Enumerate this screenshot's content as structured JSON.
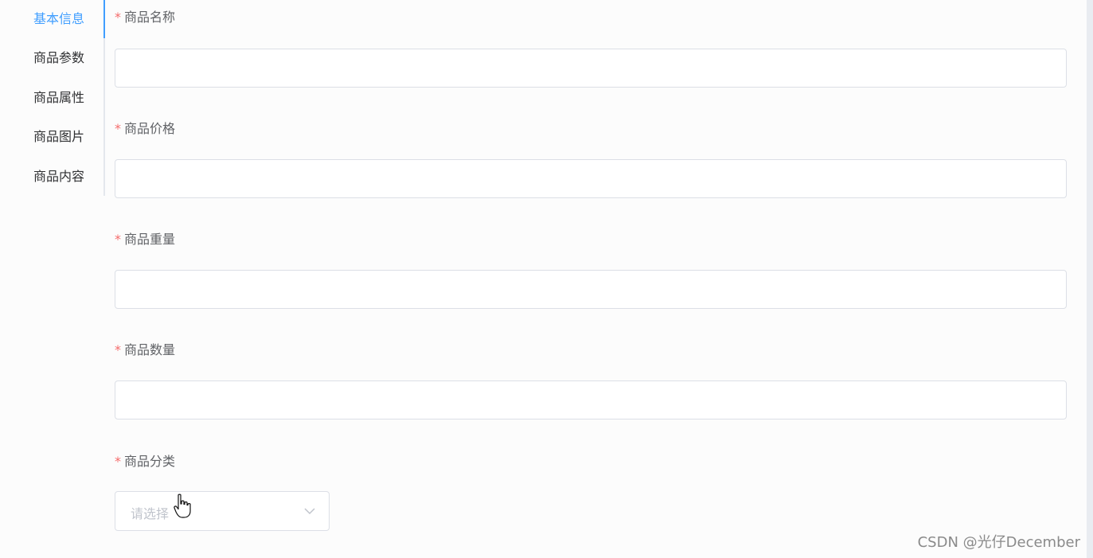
{
  "tabs": [
    {
      "label": "基本信息",
      "active": true
    },
    {
      "label": "商品参数",
      "active": false
    },
    {
      "label": "商品属性",
      "active": false
    },
    {
      "label": "商品图片",
      "active": false
    },
    {
      "label": "商品内容",
      "active": false
    }
  ],
  "form": {
    "required_mark": "*",
    "name": {
      "label": "商品名称",
      "value": ""
    },
    "price": {
      "label": "商品价格",
      "value": ""
    },
    "weight": {
      "label": "商品重量",
      "value": ""
    },
    "number": {
      "label": "商品数量",
      "value": ""
    },
    "category": {
      "label": "商品分类",
      "placeholder": "请选择"
    }
  },
  "watermark": "CSDN @光仔December",
  "colors": {
    "accent": "#409eff",
    "required": "#f56c6c",
    "border": "#dcdfe6",
    "placeholder": "#c0c4cc"
  },
  "icons": {
    "select_arrow": "chevron-down-icon",
    "cursor": "hand-pointer-icon"
  }
}
